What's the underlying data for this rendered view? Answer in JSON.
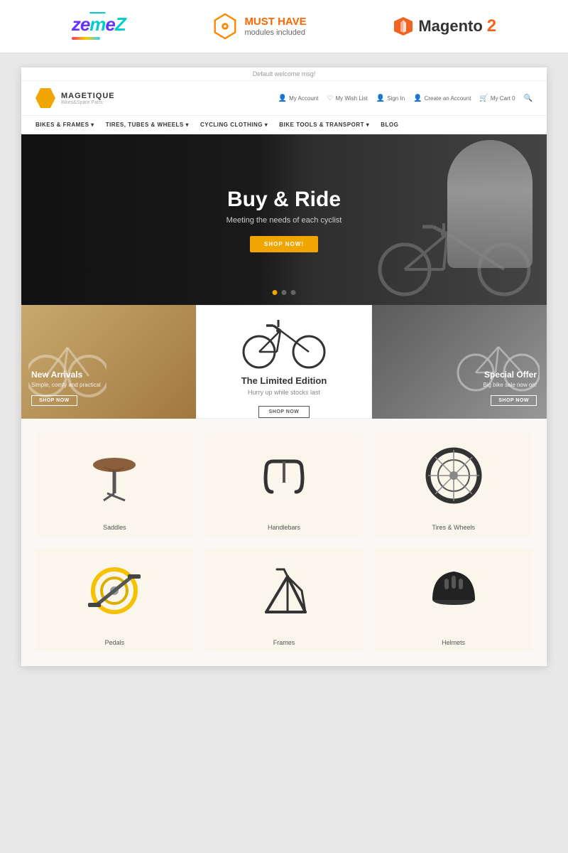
{
  "top_badges": {
    "zemes_label": "zemeZ",
    "musthave_line1": "MUST HAVE",
    "musthave_line2": "modules included",
    "magento_label": "Magento",
    "magento_version": "2"
  },
  "store": {
    "welcome_msg": "Default welcome msg!",
    "logo_name": "MAGETIQUE",
    "logo_sub": "Bikes&Spare Parts",
    "header_actions": [
      {
        "label": "My Account",
        "icon": "👤"
      },
      {
        "label": "My Wish List",
        "icon": "♡"
      },
      {
        "label": "Sign In",
        "icon": "👤"
      },
      {
        "label": "Create an Account",
        "icon": "👤"
      },
      {
        "label": "My Cart  0",
        "icon": "🛒"
      },
      {
        "label": "🔍",
        "icon": "🔍"
      }
    ],
    "nav_items": [
      "BIKES & FRAMES ▾",
      "TIRES, TUBES & WHEELS ▾",
      "CYCLING CLOTHING ▾",
      "BIKE TOOLS & TRANSPORT ▾",
      "BLOG"
    ]
  },
  "hero": {
    "title": "Buy & Ride",
    "subtitle": "Meeting the needs of each cyclist",
    "button_label": "SHOP NOW!",
    "dots": [
      true,
      false,
      false
    ]
  },
  "promo_boxes": [
    {
      "id": "new-arrivals",
      "title": "New Arrivals",
      "subtitle": "Simple, comfy and practical",
      "button": "SHOP NOW"
    },
    {
      "id": "limited-edition",
      "title": "The Limited Edition",
      "subtitle": "Hurry up while stocks last",
      "button": "SHOP NOW"
    },
    {
      "id": "special-offer",
      "title": "Special Offer",
      "subtitle": "Big bike sale now on!",
      "button": "SHOP NOW"
    }
  ],
  "categories": [
    {
      "id": "saddles",
      "label": "Saddles",
      "color": "#faf6ec"
    },
    {
      "id": "handlebars",
      "label": "Handlebars",
      "color": "#faf6ec"
    },
    {
      "id": "tires-wheels",
      "label": "Tires & Wheels",
      "color": "#faf6ec"
    },
    {
      "id": "pedals",
      "label": "Pedals",
      "color": "#faf6ec"
    },
    {
      "id": "frames",
      "label": "Frames",
      "color": "#faf6ec"
    },
    {
      "id": "helmets",
      "label": "Helmets",
      "color": "#faf6ec"
    }
  ]
}
